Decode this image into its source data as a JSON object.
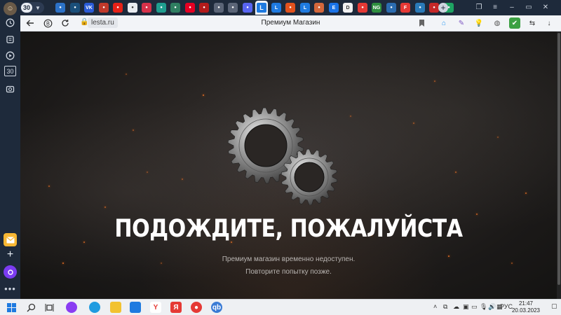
{
  "colors": {
    "sidebar_bg": "#1e2a3b",
    "addressbar_bg": "#f2f4f7",
    "page_bg": "#1b1918",
    "headline": "#ffffff",
    "subtext": "#b9b5b2",
    "spark": "#ff7a2a",
    "taskbar_bg": "#eef0f3"
  },
  "sidebar": {
    "avatar_icon": "user-avatar-icon",
    "items": [
      {
        "icon": "history-clock-icon"
      },
      {
        "icon": "notes-icon"
      },
      {
        "icon": "play-icon"
      },
      {
        "icon": "calendar-30-icon",
        "label": "30"
      },
      {
        "icon": "screenshot-icon"
      },
      {
        "icon": "mail-icon"
      },
      {
        "icon": "add-panel-icon"
      },
      {
        "icon": "alice-assistant-icon"
      },
      {
        "icon": "more-dots-icon",
        "label": "•••"
      }
    ]
  },
  "tabstrip": {
    "tab_count": "30",
    "tabs": [
      {
        "icon": "target-icon",
        "color": "#2c72c8"
      },
      {
        "icon": "eye-icon",
        "color": "#1a4f7a"
      },
      {
        "icon": "vk-icon",
        "color": "#2a5bd7",
        "label": "VK"
      },
      {
        "icon": "news-icon",
        "color": "#c0392b"
      },
      {
        "icon": "youtube-icon",
        "color": "#e62117"
      },
      {
        "icon": "document-icon",
        "color": "#e9ecf0"
      },
      {
        "icon": "circle-icon",
        "color": "#d6324a"
      },
      {
        "icon": "chat-icon",
        "color": "#1f9e8f"
      },
      {
        "icon": "copy-icon",
        "color": "#2f7e61"
      },
      {
        "icon": "pinterest-icon",
        "color": "#e60023"
      },
      {
        "icon": "red-circle-icon",
        "color": "#b31b1b"
      },
      {
        "icon": "scroll-icon",
        "color": "#5b6577"
      },
      {
        "icon": "scroll-icon",
        "color": "#5b6577"
      },
      {
        "icon": "discord-icon",
        "color": "#5865f2"
      },
      {
        "icon": "lesta-icon",
        "color": "#1e7ae0",
        "label": "L",
        "active": true
      },
      {
        "icon": "lesta-icon",
        "color": "#1e7ae0",
        "label": "L"
      },
      {
        "icon": "ball-icon",
        "color": "#e2521d"
      },
      {
        "icon": "lesta-icon",
        "color": "#1e7ae0",
        "label": "L"
      },
      {
        "icon": "box-icon",
        "color": "#d4673b"
      },
      {
        "icon": "e-icon",
        "color": "#1a73e8",
        "label": "E"
      },
      {
        "icon": "d-icon",
        "color": "#f1f1f1",
        "label": "D"
      },
      {
        "icon": "pokeball-icon",
        "color": "#e53935"
      },
      {
        "icon": "ng-icon",
        "color": "#2f8f3f",
        "label": "NG"
      },
      {
        "icon": "pen-icon",
        "color": "#2b6cb0"
      },
      {
        "icon": "f-icon",
        "color": "#e53935",
        "label": "F"
      },
      {
        "icon": "wave-icon",
        "color": "#2a7ab8"
      },
      {
        "icon": "flag-icon",
        "color": "#c62828"
      },
      {
        "icon": "grid-icon",
        "color": "#1ea362"
      }
    ],
    "window_buttons": [
      "bookmark-icon",
      "menu-icon",
      "minimize-icon",
      "maximize-icon",
      "close-icon"
    ]
  },
  "addressbar": {
    "back_icon": "back-arrow-icon",
    "yandex_icon": "yandex-b-icon",
    "reload_icon": "reload-icon",
    "url": "lesta.ru",
    "page_title": "Премиум Магазин",
    "bookmark_icon": "bookmark-flag-icon",
    "extensions": [
      {
        "icon": "home-icon",
        "color": "#2196f3"
      },
      {
        "icon": "pen-icon",
        "color": "#7e57c2"
      },
      {
        "icon": "bulb-icon",
        "color": "#555555"
      },
      {
        "icon": "globe-icon",
        "color": "#555555"
      },
      {
        "icon": "shield-icon",
        "color": "#3ca043"
      },
      {
        "icon": "translate-icon",
        "color": "#333333"
      },
      {
        "icon": "download-icon",
        "color": "#333333"
      }
    ]
  },
  "page": {
    "headline": "ПОДОЖДИТЕ, ПОЖАЛУЙСТА",
    "message_line1": "Премиум магазин временно недоступен.",
    "message_line2": "Повторите попытку позже.",
    "graphic_icon": "gears-icon"
  },
  "taskbar": {
    "icons": [
      {
        "icon": "windows-start-icon",
        "color": "#1e7ae0"
      },
      {
        "icon": "search-icon",
        "color": "#333333"
      },
      {
        "icon": "task-view-icon",
        "color": "#333333"
      },
      {
        "icon": "alice-icon",
        "color": "#8a3cf2"
      },
      {
        "icon": "edge-icon",
        "color": "#1f9be0"
      },
      {
        "icon": "explorer-icon",
        "color": "#f2c230"
      },
      {
        "icon": "mail-icon",
        "color": "#1e7ae0"
      },
      {
        "icon": "yandex-icon",
        "color": "#ffffff",
        "label": "Y"
      },
      {
        "icon": "yandex-browser-icon",
        "color": "#e53935",
        "label": "Я"
      },
      {
        "icon": "record-icon",
        "color": "#e53935"
      },
      {
        "icon": "qbittorrent-icon",
        "color": "#3a7bd5",
        "label": "qb"
      }
    ],
    "tray": [
      "chevron-up-icon",
      "copy-icon",
      "cloud-icon",
      "camera-icon",
      "monitor-icon",
      "mic-icon",
      "volume-icon",
      "network-icon"
    ],
    "language": "РУС",
    "time": "21:47",
    "date": "20.03.2023",
    "notification_icon": "notification-icon"
  }
}
